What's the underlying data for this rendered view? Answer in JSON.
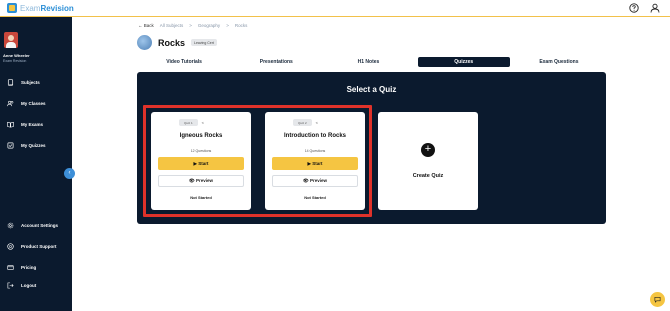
{
  "app": {
    "logo_main": "Exam",
    "logo_accent": "Revision"
  },
  "user": {
    "name": "Anne Wheeler",
    "subtitle": "Exam Revision"
  },
  "sidebar": {
    "items": [
      {
        "label": "Subjects",
        "icon": "book-icon"
      },
      {
        "label": "My Classes",
        "icon": "users-icon"
      },
      {
        "label": "My Exams",
        "icon": "open-book-icon"
      },
      {
        "label": "My Quizzes",
        "icon": "checkbox-icon"
      }
    ],
    "bottom_items": [
      {
        "label": "Account Settings",
        "icon": "gear-icon"
      },
      {
        "label": "Product Support",
        "icon": "help-icon"
      },
      {
        "label": "Pricing",
        "icon": "card-icon"
      },
      {
        "label": "Logout",
        "icon": "logout-icon"
      }
    ]
  },
  "breadcrumb": {
    "back": "← Back",
    "items": [
      "All Subjects",
      "Geography",
      "Rocks"
    ],
    "separator": ">"
  },
  "page": {
    "title": "Rocks",
    "badge": "Leaving Cert"
  },
  "tabs": [
    {
      "label": "Video Tutorials",
      "active": false
    },
    {
      "label": "Presentations",
      "active": false
    },
    {
      "label": "H1 Notes",
      "active": false
    },
    {
      "label": "Quizzes",
      "active": true
    },
    {
      "label": "Exam Questions",
      "active": false
    }
  ],
  "panel": {
    "title": "Select a Quiz"
  },
  "quizzes": [
    {
      "badge": "Quiz 1",
      "title": "Igneous Rocks",
      "count": "12 Questions",
      "start": "Start",
      "preview": "Preview",
      "status": "Not Started"
    },
    {
      "badge": "Quiz 2",
      "title": "Introduction to Rocks",
      "count": "14 Questions",
      "start": "Start",
      "preview": "Preview",
      "status": "Not Started"
    }
  ],
  "create": {
    "label": "Create Quiz"
  },
  "colors": {
    "accent": "#f5c542",
    "navy": "#0b1a2e",
    "highlight": "#e0322a",
    "brand": "#2c8fd6"
  }
}
